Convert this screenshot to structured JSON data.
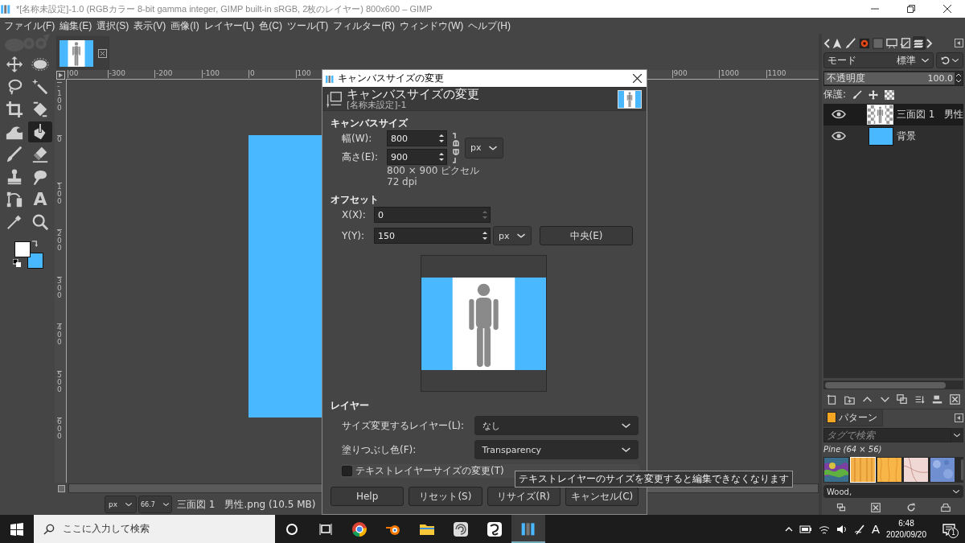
{
  "window": {
    "title": "*[名称未設定]-1.0 (RGBカラー 8-bit gamma integer, GIMP built-in sRGB, 2枚のレイヤー) 800x600 – GIMP"
  },
  "menu": [
    "ファイル(F)",
    "編集(E)",
    "選択(S)",
    "表示(V)",
    "画像(I)",
    "レイヤー(L)",
    "色(C)",
    "ツール(T)",
    "フィルター(R)",
    "ウィンドウ(W)",
    "ヘルプ(H)"
  ],
  "tools": [
    {
      "kind": "move",
      "selected": false
    },
    {
      "kind": "ellipse",
      "selected": false
    },
    {
      "kind": "lasso",
      "selected": false
    },
    {
      "kind": "wand",
      "selected": false
    },
    {
      "kind": "crop",
      "selected": false
    },
    {
      "kind": "transform",
      "selected": false
    },
    {
      "kind": "warp",
      "selected": false
    },
    {
      "kind": "bucket",
      "selected": true
    },
    {
      "kind": "brush",
      "selected": false
    },
    {
      "kind": "eraser",
      "selected": false
    },
    {
      "kind": "stamp",
      "selected": false
    },
    {
      "kind": "smudge",
      "selected": false
    },
    {
      "kind": "path",
      "selected": false
    },
    {
      "kind": "text",
      "glyph": "A",
      "selected": false
    },
    {
      "kind": "picker",
      "selected": false
    },
    {
      "kind": "zoom",
      "selected": false
    }
  ],
  "h_ruler": [
    "00",
    "-300",
    "-200",
    "-100",
    "0",
    "100",
    "900",
    "1000",
    "1100"
  ],
  "v_ruler": [
    "-100",
    "0",
    "100",
    "200",
    "300",
    "400",
    "500",
    "600"
  ],
  "status_bar": {
    "unit": "px",
    "zoom": "66.7",
    "file": "三面図 1　男性.png (10.5 MB)"
  },
  "dialog": {
    "title": "キャンバスサイズの変更",
    "header_title": "キャンバスサイズの変更",
    "header_subtitle": "[名称未設定]-1",
    "canvas_size": {
      "heading": "キャンバスサイズ",
      "width": {
        "label": "幅(W):",
        "value": "800"
      },
      "height": {
        "label": "高さ(E):",
        "value": "900"
      },
      "unit": "px",
      "info": "800 × 900 ピクセル",
      "dpi": "72 dpi"
    },
    "offset": {
      "heading": "オフセット",
      "x": {
        "label": "X(X):",
        "value": "0"
      },
      "y": {
        "label": "Y(Y):",
        "value": "150"
      },
      "unit": "px",
      "center_button": "中央(E)"
    },
    "layers": {
      "heading": "レイヤー",
      "resize_layers": {
        "label": "サイズ変更するレイヤー(L):",
        "value": "なし"
      },
      "fill": {
        "label": "塗りつぶし色(F):",
        "value": "Transparency"
      },
      "resize_text_layers": {
        "label": "テキストレイヤーサイズの変更(T)",
        "checked": false
      }
    },
    "tooltip": "テキストレイヤーのサイズを変更すると編集できなくなります",
    "buttons": [
      "Help",
      "リセット(S)",
      "リサイズ(R)",
      "キャンセル(C)"
    ]
  },
  "dock_tabs": [
    {
      "kind": "pointer",
      "selected": false
    },
    {
      "kind": "brush",
      "selected": false
    },
    {
      "kind": "dynamics",
      "selected": false
    },
    {
      "kind": "pattern",
      "selected": false
    },
    {
      "kind": "display",
      "selected": false
    },
    {
      "kind": "history",
      "selected": false
    },
    {
      "kind": "layers",
      "selected": true
    }
  ],
  "layers_panel": {
    "mode_label": "モード",
    "mode_value": "標準",
    "opacity": {
      "label": "不透明度",
      "value": "100.0",
      "level": 1
    },
    "lock_label": "保護:",
    "layers": [
      {
        "name": "三面図 1　男性",
        "kind": "figure",
        "visible": true,
        "selected": true
      },
      {
        "name": "背景",
        "kind": "fill",
        "visible": true,
        "selected": false
      }
    ]
  },
  "patterns_panel": {
    "tab": "パターン",
    "search_placeholder": "タグで検索",
    "pattern_name": "Pine (64 × 56)",
    "patterns": [
      {
        "kind": "swirl",
        "selected": false
      },
      {
        "kind": "pine",
        "selected": true
      },
      {
        "kind": "wood",
        "selected": false
      },
      {
        "kind": "marble",
        "selected": false
      },
      {
        "kind": "stone",
        "selected": false
      }
    ],
    "tag_value": "Wood,"
  },
  "taskbar": {
    "search_placeholder": "ここに入力して検索",
    "apps": [
      {
        "kind": "chrome",
        "active": false
      },
      {
        "kind": "blender",
        "active": false
      },
      {
        "kind": "folder",
        "active": false
      },
      {
        "kind": "spiral",
        "active": false
      },
      {
        "kind": "scribble",
        "active": false
      },
      {
        "kind": "gimp",
        "active": true
      }
    ],
    "ime": "A",
    "time": "6:48",
    "date": "2020/09/20",
    "notifications": "1"
  }
}
